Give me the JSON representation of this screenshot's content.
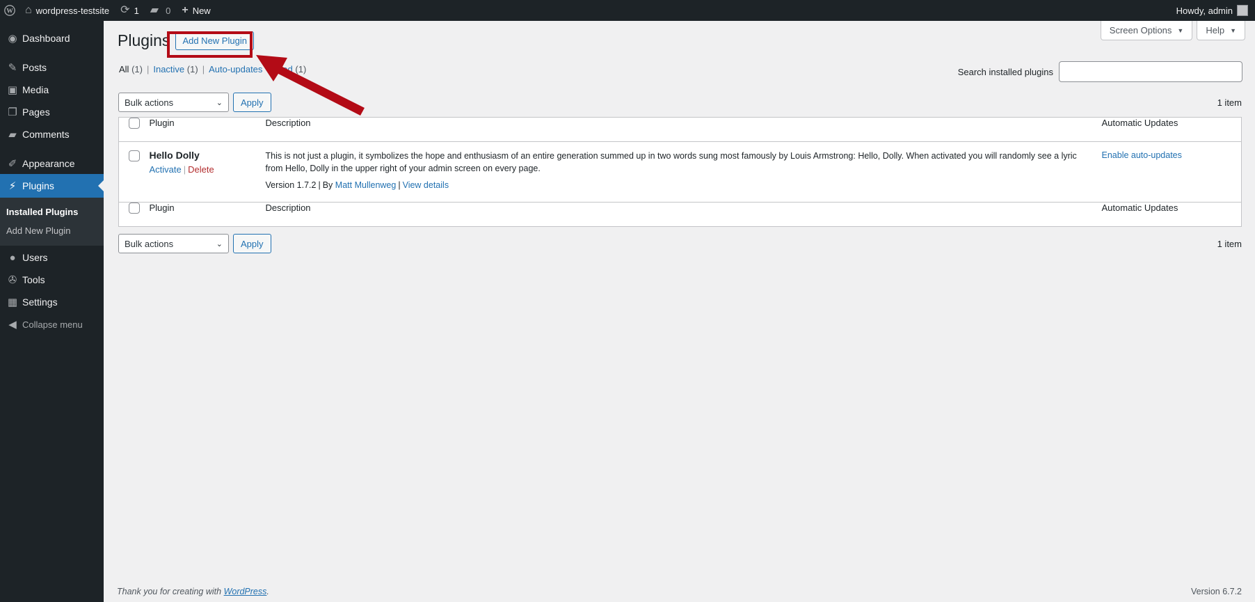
{
  "admin_bar": {
    "site_name": "wordpress-testsite",
    "updates_count": "1",
    "comments_count": "0",
    "new_label": "New",
    "howdy": "Howdy, admin"
  },
  "sidebar": {
    "items": [
      {
        "label": "Dashboard",
        "icon": "dashboard-icon"
      },
      {
        "label": "Posts",
        "icon": "pin-icon"
      },
      {
        "label": "Media",
        "icon": "media-icon"
      },
      {
        "label": "Pages",
        "icon": "pages-icon"
      },
      {
        "label": "Comments",
        "icon": "comment-icon"
      },
      {
        "label": "Appearance",
        "icon": "brush-icon"
      },
      {
        "label": "Plugins",
        "icon": "plug-icon"
      },
      {
        "label": "Users",
        "icon": "user-icon"
      },
      {
        "label": "Tools",
        "icon": "wrench-icon"
      },
      {
        "label": "Settings",
        "icon": "settings-icon"
      }
    ],
    "submenu": [
      "Installed Plugins",
      "Add New Plugin"
    ],
    "collapse_label": "Collapse menu"
  },
  "screen_meta": {
    "screen_options": "Screen Options",
    "help": "Help"
  },
  "page": {
    "title": "Plugins",
    "add_new": "Add New Plugin"
  },
  "filters": {
    "all": "All",
    "all_count": "(1)",
    "inactive": "Inactive",
    "inactive_count": "(1)",
    "auto_updates": "Auto-updates",
    "hidden_partial": "led",
    "hidden_count": "(1)"
  },
  "search": {
    "label": "Search installed plugins",
    "value": ""
  },
  "tablenav": {
    "bulk_actions": "Bulk actions",
    "apply": "Apply",
    "count": "1 item"
  },
  "table": {
    "headers": {
      "plugin": "Plugin",
      "description": "Description",
      "auto_updates": "Automatic Updates"
    },
    "rows": [
      {
        "name": "Hello Dolly",
        "activate": "Activate",
        "delete": "Delete",
        "description": "This is not just a plugin, it symbolizes the hope and enthusiasm of an entire generation summed up in two words sung most famously by Louis Armstrong: Hello, Dolly. When activated you will randomly see a lyric from Hello, Dolly in the upper right of your admin screen on every page.",
        "version": "Version 1.7.2",
        "by": "By",
        "author": "Matt Mullenweg",
        "view_details": "View details",
        "auto_update_link": "Enable auto-updates"
      }
    ]
  },
  "footer": {
    "thanks_prefix": "Thank you for creating with",
    "wordpress_link": "WordPress",
    "thanks_suffix": ".",
    "version": "Version 6.7.2"
  },
  "colors": {
    "highlight": "#b30b16",
    "accent": "#2271b1",
    "sidebar": "#1d2327"
  }
}
